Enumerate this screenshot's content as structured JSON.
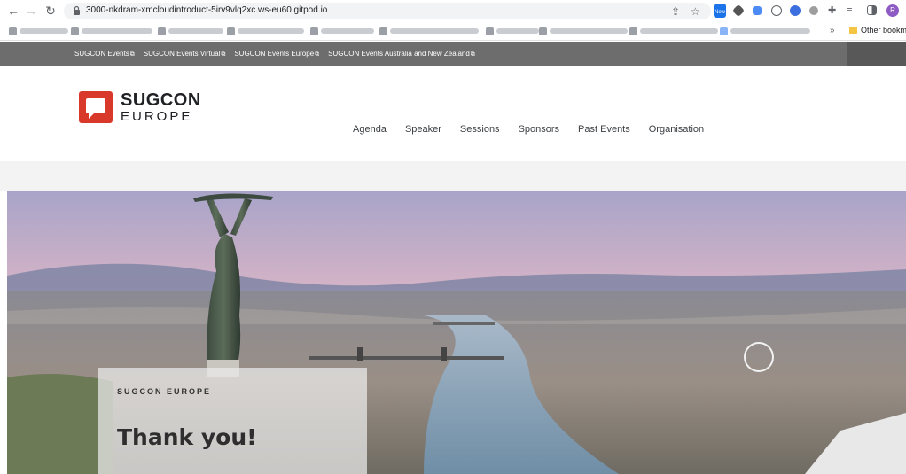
{
  "browser": {
    "url": "3000-nkdram-xmcloudintroduct-5irv9vlq2xc.ws-eu60.gitpod.io",
    "ext_badge": "New",
    "avatar_initial": "R",
    "bookmarks_more": "»",
    "bookmarks_other": "Other bookm"
  },
  "topnav": {
    "links": [
      "SUGCON Events",
      "SUGCON Events Virtual",
      "SUGCON Events Europe",
      "SUGCON Events Australia and New Zealand"
    ],
    "external_glyph": "⧉"
  },
  "logo": {
    "line1": "SUGCON",
    "line2": "EUROPE"
  },
  "mainnav": {
    "items": [
      "Agenda",
      "Speaker",
      "Sessions",
      "Sponsors",
      "Past Events",
      "Organisation"
    ]
  },
  "hero": {
    "eyebrow": "SUGCON EUROPE",
    "title": "Thank you!"
  },
  "colors": {
    "brand_red": "#d8392b",
    "topnav_bg": "#6d6d6d"
  },
  "icons": [
    "back-icon",
    "forward-icon",
    "reload-icon",
    "lock-icon",
    "share-icon",
    "star-icon",
    "extensions-icon",
    "reading-list-icon",
    "side-panel-icon"
  ]
}
